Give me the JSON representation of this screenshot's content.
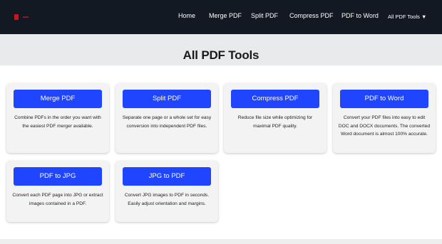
{
  "nav": {
    "items": [
      "Home",
      "Merge PDF",
      "Split PDF",
      "Compress PDF",
      "PDF to Word"
    ],
    "dropdown_label": "All PDF Tools ▼"
  },
  "hero": {
    "title": "All PDF Tools"
  },
  "tools": [
    {
      "button": "Merge PDF",
      "description": "Combine PDFs in the order you want with the easiest PDF merger available."
    },
    {
      "button": "Split PDF",
      "description": "Separate one page or a whole set for easy conversion into independent PDF files."
    },
    {
      "button": "Compress PDF",
      "description": "Reduce file size while optimizing for maximal PDF quality."
    },
    {
      "button": "PDF to Word",
      "description": "Convert your PDF files into easy to edit DOC and DOCX documents. The converted Word document is almost 100% accurate."
    },
    {
      "button": "PDF to JPG",
      "description": "Convert each PDF page into JPG or extract images contained in a PDF."
    },
    {
      "button": "JPG to PDF",
      "description": "Convert JPG images to PDF in seconds. Easily adjust orientation and margins."
    }
  ],
  "colors": {
    "navbar_bg": "#121923",
    "accent_button": "#1f45ff",
    "logo_red": "#d0141c",
    "hero_bg": "#e9eaec",
    "card_bg": "#f3f3f4"
  },
  "icons": {
    "logo": "pdf-logo-icon"
  }
}
